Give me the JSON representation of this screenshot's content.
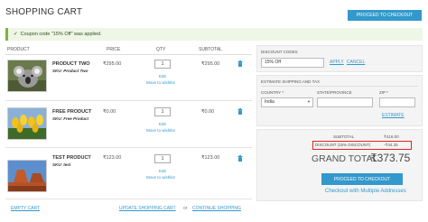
{
  "page": {
    "title": "SHOPPING CART",
    "checkout_top": "Proceed to Checkout",
    "success_message": "Coupon code \"15% Off\" was applied."
  },
  "columns": {
    "product": "PRODUCT",
    "price": "PRICE",
    "qty": "QTY",
    "subtotal": "SUBTOTAL"
  },
  "items": [
    {
      "name": "PRODUCT TWO",
      "sku": "SKU: Product Two",
      "price": "₹295.00",
      "qty": "1",
      "edit": "Edit",
      "wishlist": "Move to wishlist",
      "subtotal": "₹295.00",
      "thumb_icon": "koala-photo"
    },
    {
      "name": "FREE PRODUCT",
      "sku": "SKU: Free Product",
      "price": "₹0.00",
      "qty": "1",
      "edit": "Edit",
      "wishlist": "Move to wishlist",
      "subtotal": "₹0.00",
      "thumb_icon": "tulips-photo"
    },
    {
      "name": "TEST PRODUCT",
      "sku": "SKU: test",
      "price": "₹123.00",
      "qty": "1",
      "edit": "Edit",
      "wishlist": "Move to wishlist",
      "subtotal": "₹123.00",
      "thumb_icon": "desert-photo"
    }
  ],
  "cart_actions": {
    "empty": "EMPTY CART",
    "update": "UPDATE SHOPPING CART",
    "or": "or",
    "continue": "CONTINUE SHOPPING"
  },
  "discount": {
    "label": "DISCOUNT CODES",
    "value": "15% Off",
    "apply": "APPLY",
    "cancel": "CANCEL"
  },
  "estimate": {
    "label": "ESTIMATE SHIPPING AND TAX",
    "country_label": "COUNTRY *",
    "country_value": "India",
    "state_label": "STATE/PROVINCE",
    "state_value": "",
    "zip_label": "ZIP *",
    "zip_value": "",
    "estimate_link": "ESTIMATE"
  },
  "totals": {
    "subtotal_label": "SUBTOTAL",
    "subtotal_value": "₹418.00",
    "discount_label": "DISCOUNT (15% DISCOUNT)",
    "discount_value": "-₹44.25",
    "grand_label": "GRAND TOTAL",
    "grand_value": "₹373.75",
    "checkout_bottom": "Proceed to Checkout",
    "multi_address": "Checkout with Multiple Addresses"
  },
  "colors": {
    "accent": "#3399cc",
    "success_bg": "#eef6e6",
    "discount_highlight": "#e2231a"
  }
}
